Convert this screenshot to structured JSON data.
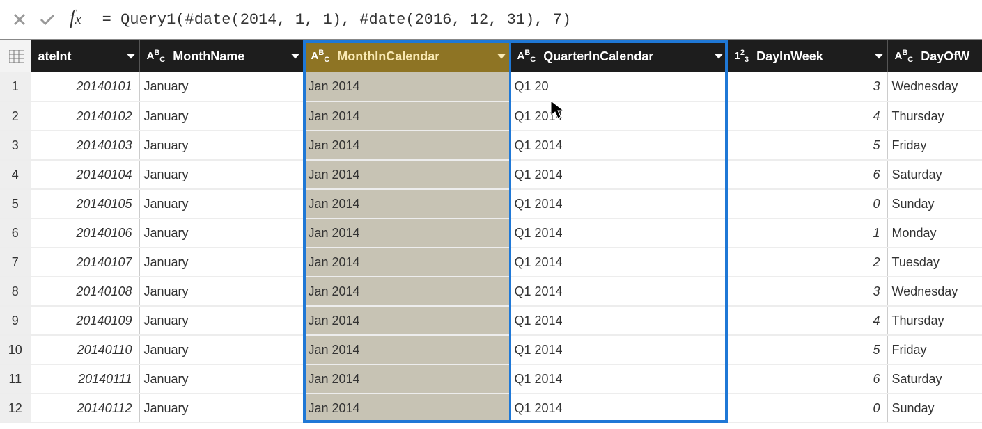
{
  "formula": "= Query1(#date(2014, 1, 1), #date(2016, 12, 31), 7)",
  "columns": [
    {
      "name": "ateInt",
      "type": "text-partial",
      "selected": false
    },
    {
      "name": "MonthName",
      "type": "abc",
      "selected": false
    },
    {
      "name": "MonthInCalendar",
      "type": "abc",
      "selected": true
    },
    {
      "name": "QuarterInCalendar",
      "type": "abc",
      "selected": false
    },
    {
      "name": "DayInWeek",
      "type": "123",
      "selected": false
    },
    {
      "name": "DayOfW",
      "type": "abc",
      "selected": false
    }
  ],
  "rows": [
    {
      "n": "1",
      "dateInt": "20140101",
      "monthName": "January",
      "monthInCal": "Jan 2014",
      "quarter": "Q1 20",
      "dayInWeek": "3",
      "dayOfW": "Wednesday"
    },
    {
      "n": "2",
      "dateInt": "20140102",
      "monthName": "January",
      "monthInCal": "Jan 2014",
      "quarter": "Q1 2014",
      "dayInWeek": "4",
      "dayOfW": "Thursday"
    },
    {
      "n": "3",
      "dateInt": "20140103",
      "monthName": "January",
      "monthInCal": "Jan 2014",
      "quarter": "Q1 2014",
      "dayInWeek": "5",
      "dayOfW": "Friday"
    },
    {
      "n": "4",
      "dateInt": "20140104",
      "monthName": "January",
      "monthInCal": "Jan 2014",
      "quarter": "Q1 2014",
      "dayInWeek": "6",
      "dayOfW": "Saturday"
    },
    {
      "n": "5",
      "dateInt": "20140105",
      "monthName": "January",
      "monthInCal": "Jan 2014",
      "quarter": "Q1 2014",
      "dayInWeek": "0",
      "dayOfW": "Sunday"
    },
    {
      "n": "6",
      "dateInt": "20140106",
      "monthName": "January",
      "monthInCal": "Jan 2014",
      "quarter": "Q1 2014",
      "dayInWeek": "1",
      "dayOfW": "Monday"
    },
    {
      "n": "7",
      "dateInt": "20140107",
      "monthName": "January",
      "monthInCal": "Jan 2014",
      "quarter": "Q1 2014",
      "dayInWeek": "2",
      "dayOfW": "Tuesday"
    },
    {
      "n": "8",
      "dateInt": "20140108",
      "monthName": "January",
      "monthInCal": "Jan 2014",
      "quarter": "Q1 2014",
      "dayInWeek": "3",
      "dayOfW": "Wednesday"
    },
    {
      "n": "9",
      "dateInt": "20140109",
      "monthName": "January",
      "monthInCal": "Jan 2014",
      "quarter": "Q1 2014",
      "dayInWeek": "4",
      "dayOfW": "Thursday"
    },
    {
      "n": "10",
      "dateInt": "20140110",
      "monthName": "January",
      "monthInCal": "Jan 2014",
      "quarter": "Q1 2014",
      "dayInWeek": "5",
      "dayOfW": "Friday"
    },
    {
      "n": "11",
      "dateInt": "20140111",
      "monthName": "January",
      "monthInCal": "Jan 2014",
      "quarter": "Q1 2014",
      "dayInWeek": "6",
      "dayOfW": "Saturday"
    },
    {
      "n": "12",
      "dateInt": "20140112",
      "monthName": "January",
      "monthInCal": "Jan 2014",
      "quarter": "Q1 2014",
      "dayInWeek": "0",
      "dayOfW": "Sunday"
    }
  ]
}
